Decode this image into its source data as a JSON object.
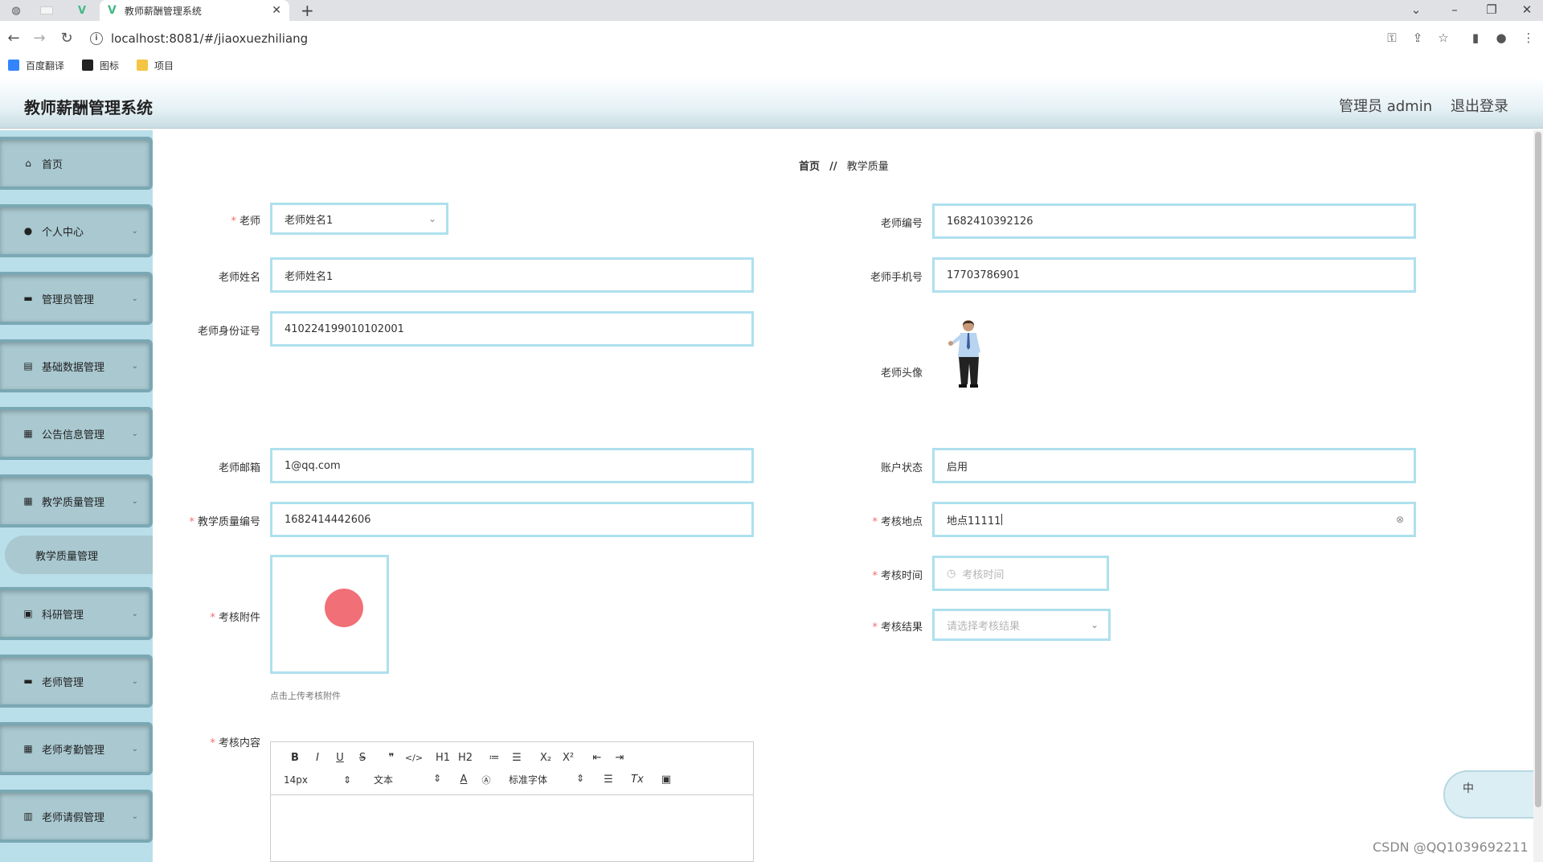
{
  "browser": {
    "tab_title": "教师薪酬管理系统",
    "url": "localhost:8081/#/jiaoxuezhiliang",
    "bookmarks": [
      "百度翻译",
      "图标",
      "项目"
    ]
  },
  "app": {
    "title": "教师薪酬管理系统",
    "user_label": "管理员 admin",
    "logout_label": "退出登录"
  },
  "sidebar": {
    "items": [
      {
        "label": "首页",
        "icon": "home-icon"
      },
      {
        "label": "个人中心",
        "icon": "user-icon"
      },
      {
        "label": "管理员管理",
        "icon": "briefcase-icon"
      },
      {
        "label": "基础数据管理",
        "icon": "document-icon"
      },
      {
        "label": "公告信息管理",
        "icon": "grid-icon"
      },
      {
        "label": "教学质量管理",
        "icon": "grid-icon"
      },
      {
        "label": "科研管理",
        "icon": "flask-icon"
      },
      {
        "label": "老师管理",
        "icon": "monitor-icon"
      },
      {
        "label": "老师考勤管理",
        "icon": "grid-icon"
      },
      {
        "label": "老师请假管理",
        "icon": "chart-icon"
      }
    ],
    "sub_item": "教学质量管理"
  },
  "breadcrumb": {
    "home": "首页",
    "separator": "//",
    "current": "教学质量"
  },
  "form": {
    "teacher_label": "老师",
    "teacher_value": "老师姓名1",
    "teacher_no_label": "老师编号",
    "teacher_no_value": "1682410392126",
    "teacher_name_label": "老师姓名",
    "teacher_name_value": "老师姓名1",
    "teacher_phone_label": "老师手机号",
    "teacher_phone_value": "17703786901",
    "teacher_id_label": "老师身份证号",
    "teacher_id_value": "410224199010102001",
    "teacher_avatar_label": "老师头像",
    "teacher_email_label": "老师邮箱",
    "teacher_email_value": "1@qq.com",
    "account_status_label": "账户状态",
    "account_status_value": "启用",
    "quality_no_label": "教学质量编号",
    "quality_no_value": "1682414442606",
    "exam_place_label": "考核地点",
    "exam_place_value": "地点11111",
    "exam_time_label": "考核时间",
    "exam_time_placeholder": "考核时间",
    "exam_result_label": "考核结果",
    "exam_result_placeholder": "请选择考核结果",
    "attachment_label": "考核附件",
    "attachment_hint": "点击上传考核附件",
    "content_label": "考核内容"
  },
  "editor": {
    "toolbar_row1": [
      "B",
      "I",
      "U",
      "S",
      "❞",
      "</>",
      "H1",
      "H2",
      "≔",
      "☰",
      "X₂",
      "X²",
      "⇤",
      "⇥"
    ],
    "font_size": "14px",
    "text_style": "文本",
    "font_family": "标准字体"
  },
  "ime": {
    "label": "中"
  },
  "watermark": "CSDN @QQ1039692211",
  "colors": {
    "input_border": "#aee0ee",
    "sidebar_bg": "#b9dfea",
    "required": "#f56c6c"
  }
}
